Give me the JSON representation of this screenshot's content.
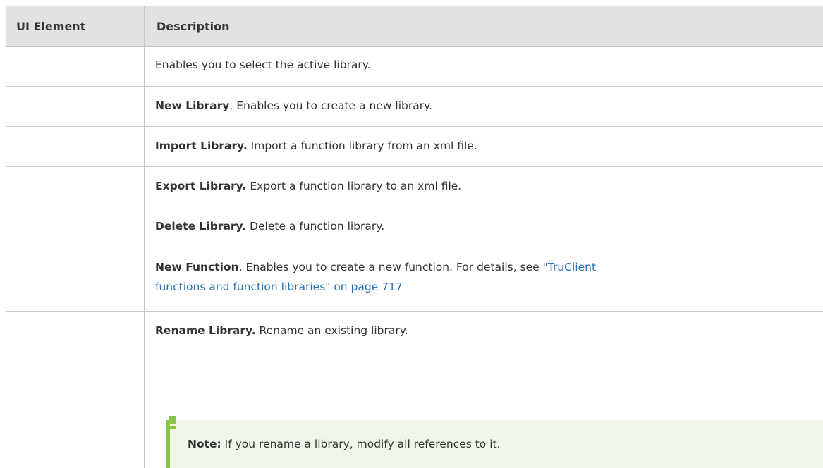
{
  "header": {
    "col1": "UI Element",
    "col2": "Description"
  },
  "rows": [
    {
      "bold": "",
      "text": "Enables you to select the active library."
    },
    {
      "bold": "New Library",
      "text": ". Enables you to create a new library."
    },
    {
      "bold": "Import Library.",
      "text": " Import a function library from an xml file."
    },
    {
      "bold": "Export Library.",
      "text": " Export a function library to an xml file."
    },
    {
      "bold": "Delete Library.",
      "text": " Delete a function library."
    },
    {
      "bold": "New Function",
      "text": ". Enables you to create a new function. For details, see ",
      "link1": "\"TruClient",
      "link2": "functions and function libraries\" on page 717"
    },
    {
      "bold": "Rename Library.",
      "text": " Rename an existing library."
    }
  ],
  "note": {
    "label": "Note:",
    "text": " If you rename a library, modify all references to it."
  },
  "colors": {
    "header_bg": "#e2e2e2",
    "link": "#2673b6",
    "note_bg": "#f0f7e9",
    "note_accent": "#89c446"
  }
}
